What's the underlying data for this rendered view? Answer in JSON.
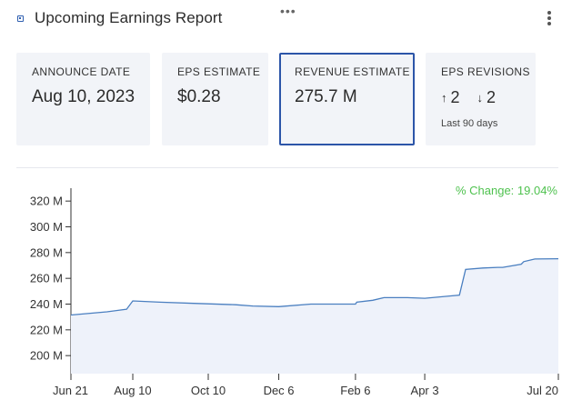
{
  "header": {
    "title": "Upcoming Earnings Report",
    "icon": "widget-square-icon",
    "drag_handle": "drag-dots-icon",
    "menu": "kebab-menu-icon"
  },
  "cards": [
    {
      "label": "ANNOUNCE DATE",
      "value": "Aug 10, 2023"
    },
    {
      "label": "EPS ESTIMATE",
      "value": "$0.28"
    },
    {
      "label": "REVENUE ESTIMATE",
      "value": "275.7 M",
      "selected": true
    },
    {
      "label": "EPS REVISIONS",
      "up": "2",
      "down": "2",
      "sub": "Last 90 days"
    }
  ],
  "chart_data": {
    "type": "line",
    "annotation": "% Change: 19.04%",
    "y_ticks": [
      "200 M",
      "220 M",
      "240 M",
      "260 M",
      "280 M",
      "300 M",
      "320 M"
    ],
    "x_ticks": [
      "Jun 21",
      "Aug 10",
      "Oct 10",
      "Dec 6",
      "Feb 6",
      "Apr 3",
      "Jul 20"
    ],
    "ylim": [
      186,
      330
    ],
    "xlim": [
      "2022-06-21",
      "2023-07-20"
    ],
    "series": [
      {
        "x": [
          "2022-06-21",
          "2022-07-20",
          "2022-08-05",
          "2022-08-10",
          "2022-09-01",
          "2022-10-01",
          "2022-11-01",
          "2022-11-15",
          "2022-12-06",
          "2023-01-01",
          "2023-02-06",
          "2023-02-07",
          "2023-02-20",
          "2023-03-01",
          "2023-03-20",
          "2023-04-03",
          "2023-04-20",
          "2023-05-01",
          "2023-05-06",
          "2023-05-20",
          "2023-06-01",
          "2023-06-05",
          "2023-06-20",
          "2023-06-22",
          "2023-07-01",
          "2023-07-20"
        ],
        "y": [
          231.5,
          234,
          236,
          242.5,
          241.5,
          240.5,
          239.5,
          238.5,
          238,
          240,
          240,
          241.5,
          243,
          245,
          245,
          244.5,
          246,
          247,
          267,
          268,
          268.5,
          268.5,
          271,
          273,
          275,
          275.2
        ]
      }
    ],
    "grid": false
  }
}
